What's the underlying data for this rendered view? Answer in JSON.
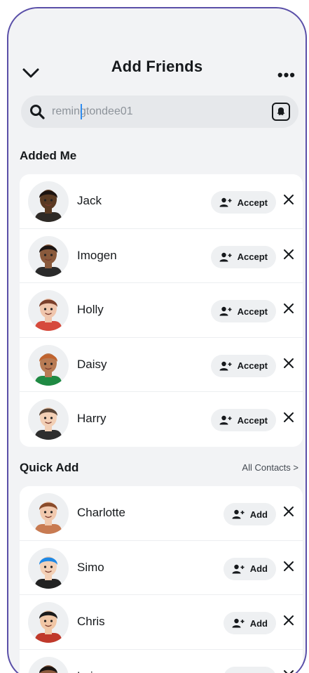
{
  "header": {
    "title": "Add Friends",
    "more": "•••"
  },
  "search": {
    "value": "remingtondee01"
  },
  "added_me": {
    "title": "Added Me",
    "accept_label": "Accept",
    "items": [
      {
        "name": "Jack",
        "skin": "#5a3a22",
        "hair": "#1d1410",
        "shirt": "#2e2a26"
      },
      {
        "name": "Imogen",
        "skin": "#8a5a3c",
        "hair": "#1b1412",
        "shirt": "#2a2a2a"
      },
      {
        "name": "Holly",
        "skin": "#f0c6ad",
        "hair": "#7b3f2b",
        "shirt": "#d64a3c"
      },
      {
        "name": "Daisy",
        "skin": "#b87b54",
        "hair": "#c0632e",
        "shirt": "#1f8a43"
      },
      {
        "name": "Harry",
        "skin": "#f2cfb5",
        "hair": "#5a4638",
        "shirt": "#2e2e2e"
      }
    ]
  },
  "quick_add": {
    "title": "Quick Add",
    "all_contacts": "All Contacts >",
    "add_label": "Add",
    "items": [
      {
        "name": "Charlotte",
        "skin": "#f1c9ae",
        "hair": "#8a4b2a",
        "shirt": "#c87b52"
      },
      {
        "name": "Simo",
        "skin": "#f3d0b6",
        "hair": "#1e88e5",
        "shirt": "#222222"
      },
      {
        "name": "Chris",
        "skin": "#f1c7a6",
        "hair": "#1a1a1a",
        "shirt": "#c0392b"
      },
      {
        "name": "Luiza",
        "skin": "#8d5b3e",
        "hair": "#1a1412",
        "shirt": "#333333"
      }
    ]
  },
  "colors": {
    "frame": "#5a4fa8",
    "background": "#f2f3f5",
    "pill": "#eef0f2",
    "caret": "#2d8cf0"
  }
}
